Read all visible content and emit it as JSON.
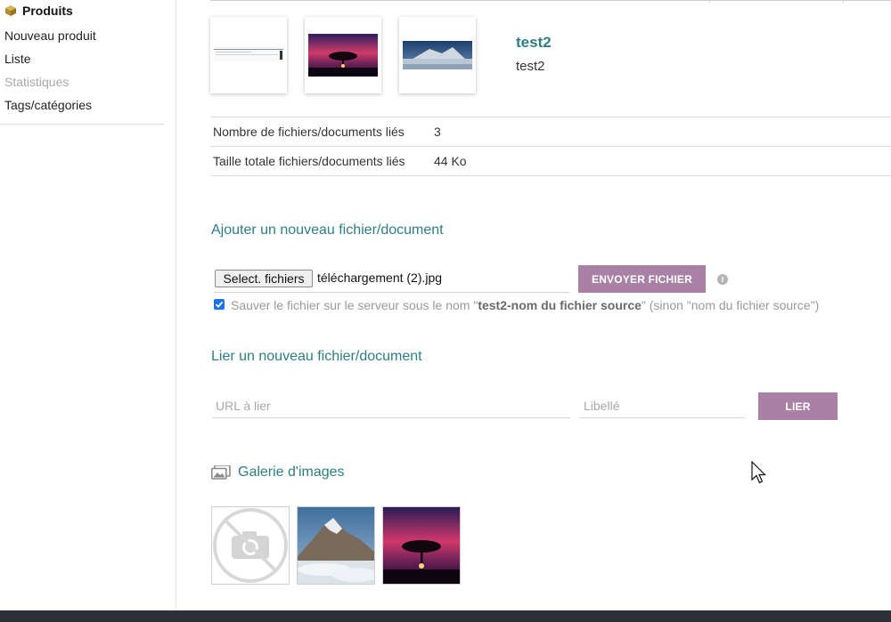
{
  "sidebar": {
    "title": "Produits",
    "items": [
      {
        "label": "Nouveau produit",
        "disabled": false
      },
      {
        "label": "Liste",
        "disabled": false
      },
      {
        "label": "Statistiques",
        "disabled": true
      },
      {
        "label": "Tags/catégories",
        "disabled": false
      }
    ]
  },
  "product": {
    "name": "test2",
    "subtitle": "test2"
  },
  "info": {
    "rows": [
      {
        "label": "Nombre de fichiers/documents liés",
        "value": "3"
      },
      {
        "label": "Taille totale fichiers/documents liés",
        "value": "44 Ko"
      }
    ]
  },
  "upload": {
    "heading": "Ajouter un nouveau fichier/document",
    "select_label": "Select. fichiers",
    "file_name": "téléchargement (2).jpg",
    "send_label": "ENVOYER FICHIER",
    "checkbox_checked": true,
    "checkbox_prefix": "Sauver le fichier sur le serveur sous le nom \"",
    "checkbox_bold": "test2-nom du fichier source",
    "checkbox_suffix": "\" (sinon \"nom du fichier source\")"
  },
  "link": {
    "heading": "Lier un nouveau fichier/document",
    "url_placeholder": "URL à lier",
    "label_placeholder": "Libellé",
    "button_label": "LIER"
  },
  "gallery": {
    "heading": "Galerie d'images"
  },
  "colors": {
    "accent": "#2e7e86",
    "button": "#a980a6",
    "checkbox": "#1a73e8"
  }
}
